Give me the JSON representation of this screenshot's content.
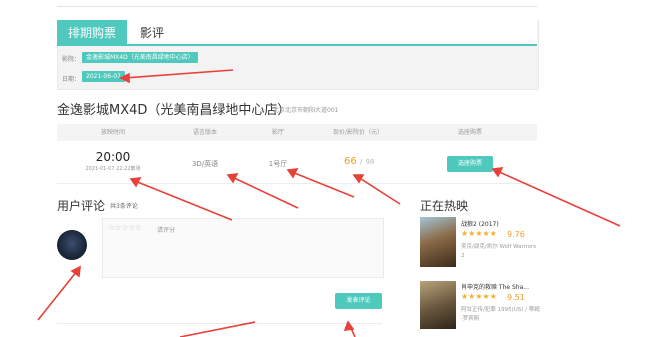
{
  "tabs": [
    {
      "label": "排期购票"
    },
    {
      "label": "影评"
    }
  ],
  "filters": {
    "cinema_label": "影院：",
    "cinema_value": "金逸影城MX4D（光美南昌绿地中心店）",
    "date_label": "日期：",
    "date_value": "2021-06-07"
  },
  "cinema": {
    "name": "金逸影城MX4D（光美南昌绿地中心店）",
    "address": "北京北京市朝阳大道001"
  },
  "schedule": {
    "headers": [
      "放映时间",
      "语言版本",
      "影厅",
      "现价/影院价（元）",
      "选座购票"
    ],
    "rows": [
      {
        "time": "20:00",
        "end": "2021-01-07 22:22散场",
        "lang": "3D/英语",
        "hall": "1号厅",
        "price": "66",
        "sep": "/",
        "orig": "98",
        "action": "选座购票"
      }
    ]
  },
  "comments": {
    "title": "用户评论",
    "count": "共3条评论",
    "rating_placeholder": "请评分",
    "rating_stars": "☆☆☆☆☆",
    "submit": "发表评论"
  },
  "hot": {
    "title": "正在热映",
    "movies": [
      {
        "title": "战狼2 (2017)",
        "stars": "★★★★★",
        "score": "9.76",
        "meta": "吴京/邵克/凯尔·Wolf Warriors 2"
      },
      {
        "title": "肖申克的救赎 The Sha...",
        "stars": "★★★★★",
        "score": "9.51",
        "meta": "阿甘正传/犯罪 1995(US) / 蒂姆·罗宾斯"
      }
    ]
  },
  "colors": {
    "accent": "#4fc9be",
    "price": "#f0a020",
    "annotation": "#e8403a"
  }
}
